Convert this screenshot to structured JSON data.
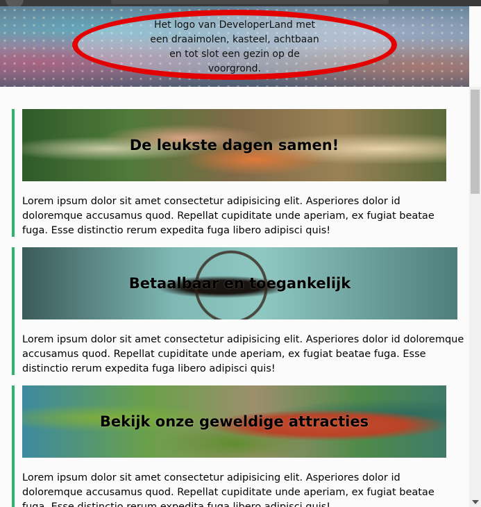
{
  "header": {
    "logo_alt_text": "Het logo van DeveloperLand met een draaimolen, kasteel, achtbaan en tot slot een gezin op de voorgrond."
  },
  "sections": [
    {
      "title": "De leukste dagen samen!",
      "text": "Lorem ipsum dolor sit amet consectetur adipisicing elit. Asperiores dolor id doloremque accusamus quod. Repellat cupiditate unde aperiam, ex fugiat beatae fuga. Esse distinctio rerum expedita fuga libero adipisci quis!"
    },
    {
      "title": "Betaalbaar en toegankelijk",
      "text": "Lorem ipsum dolor sit amet consectetur adipisicing elit. Asperiores dolor id doloremque accusamus quod. Repellat cupiditate unde aperiam, ex fugiat beatae fuga. Esse distinctio rerum expedita fuga libero adipisci quis!"
    },
    {
      "title": "Bekijk onze geweldige attracties",
      "text": "Lorem ipsum dolor sit amet consectetur adipisicing elit. Asperiores dolor id doloremque accusamus quod. Repellat cupiditate unde aperiam, ex fugiat beatae fuga. Esse distinctio rerum expedita fuga libero adipisci quis!"
    }
  ],
  "colors": {
    "accent": "#2fb36d",
    "annotation_oval": "#e20000"
  }
}
